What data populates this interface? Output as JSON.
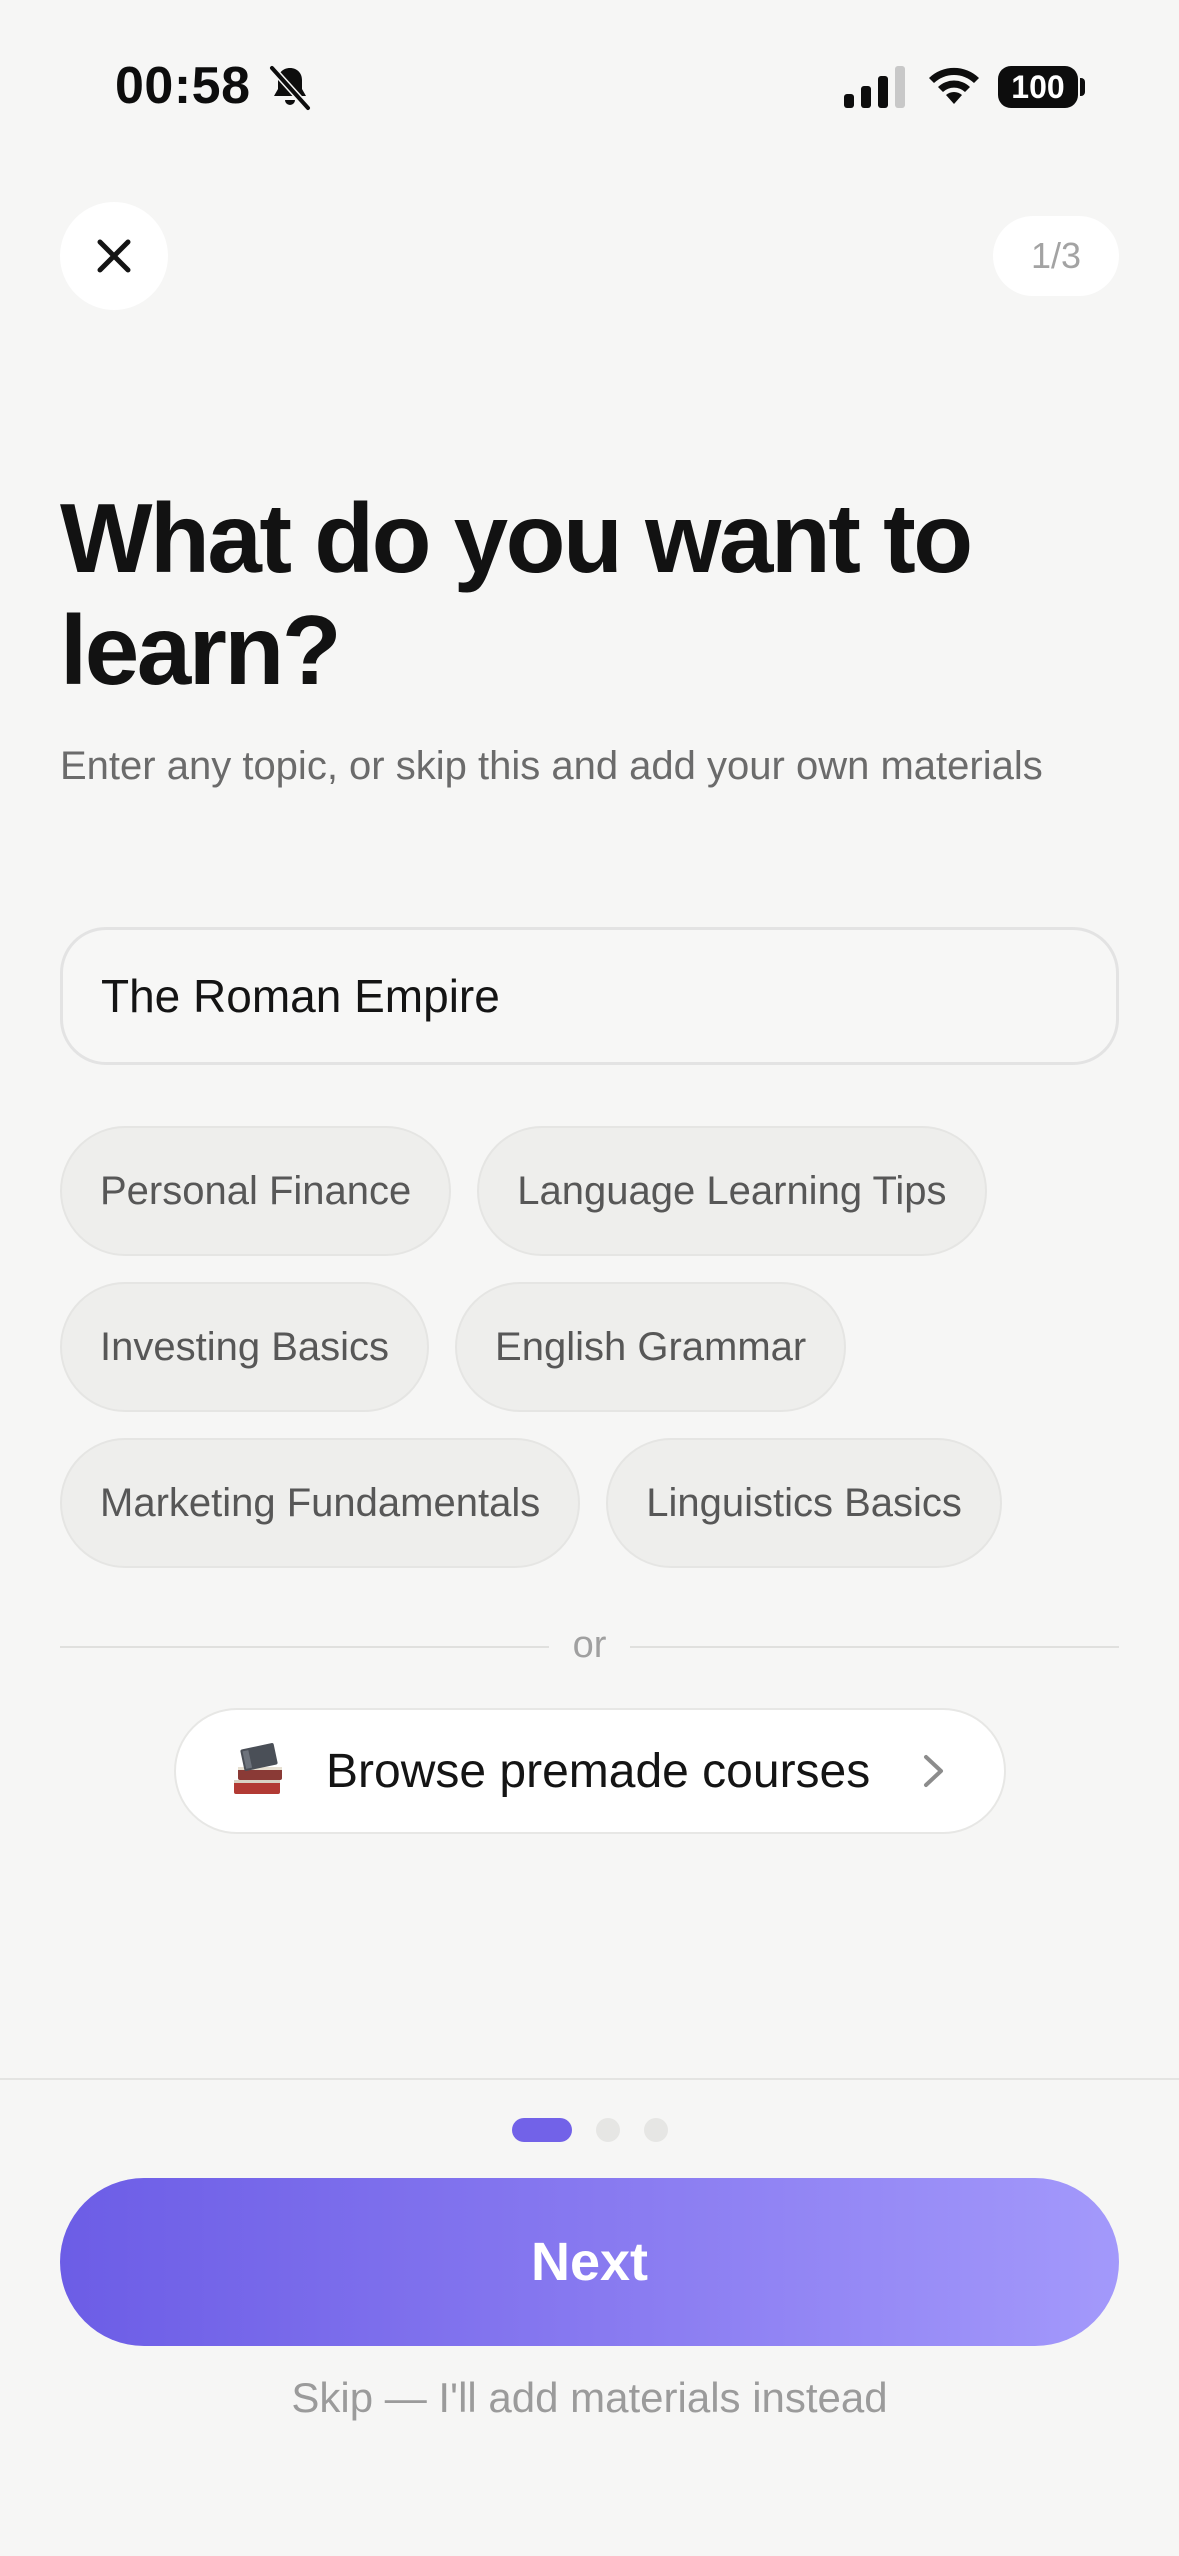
{
  "status_bar": {
    "time": "00:58",
    "battery": "100",
    "icons": [
      "bell-off-icon",
      "cellular-signal-icon",
      "wifi-icon",
      "battery-icon"
    ]
  },
  "header": {
    "close_icon": "close-icon",
    "step": "1/3"
  },
  "main": {
    "title": "What do you want to learn?",
    "subtitle": "Enter any topic, or skip this and add your own materials",
    "topic_input": {
      "value": "The Roman Empire"
    },
    "suggestions": [
      "Personal Finance",
      "Language Learning Tips",
      "Investing Basics",
      "English Grammar",
      "Marketing Fundamentals",
      "Linguistics Basics"
    ],
    "divider_text": "or",
    "browse": {
      "icon": "books-icon",
      "label": "Browse premade courses"
    }
  },
  "footer": {
    "pagination": {
      "current": 1,
      "total": 3
    },
    "next_label": "Next",
    "skip_label": "Skip — I'll add materials instead"
  },
  "colors": {
    "accent": "#7262e8",
    "accent_light": "#a399fb",
    "background": "#f6f6f5"
  }
}
